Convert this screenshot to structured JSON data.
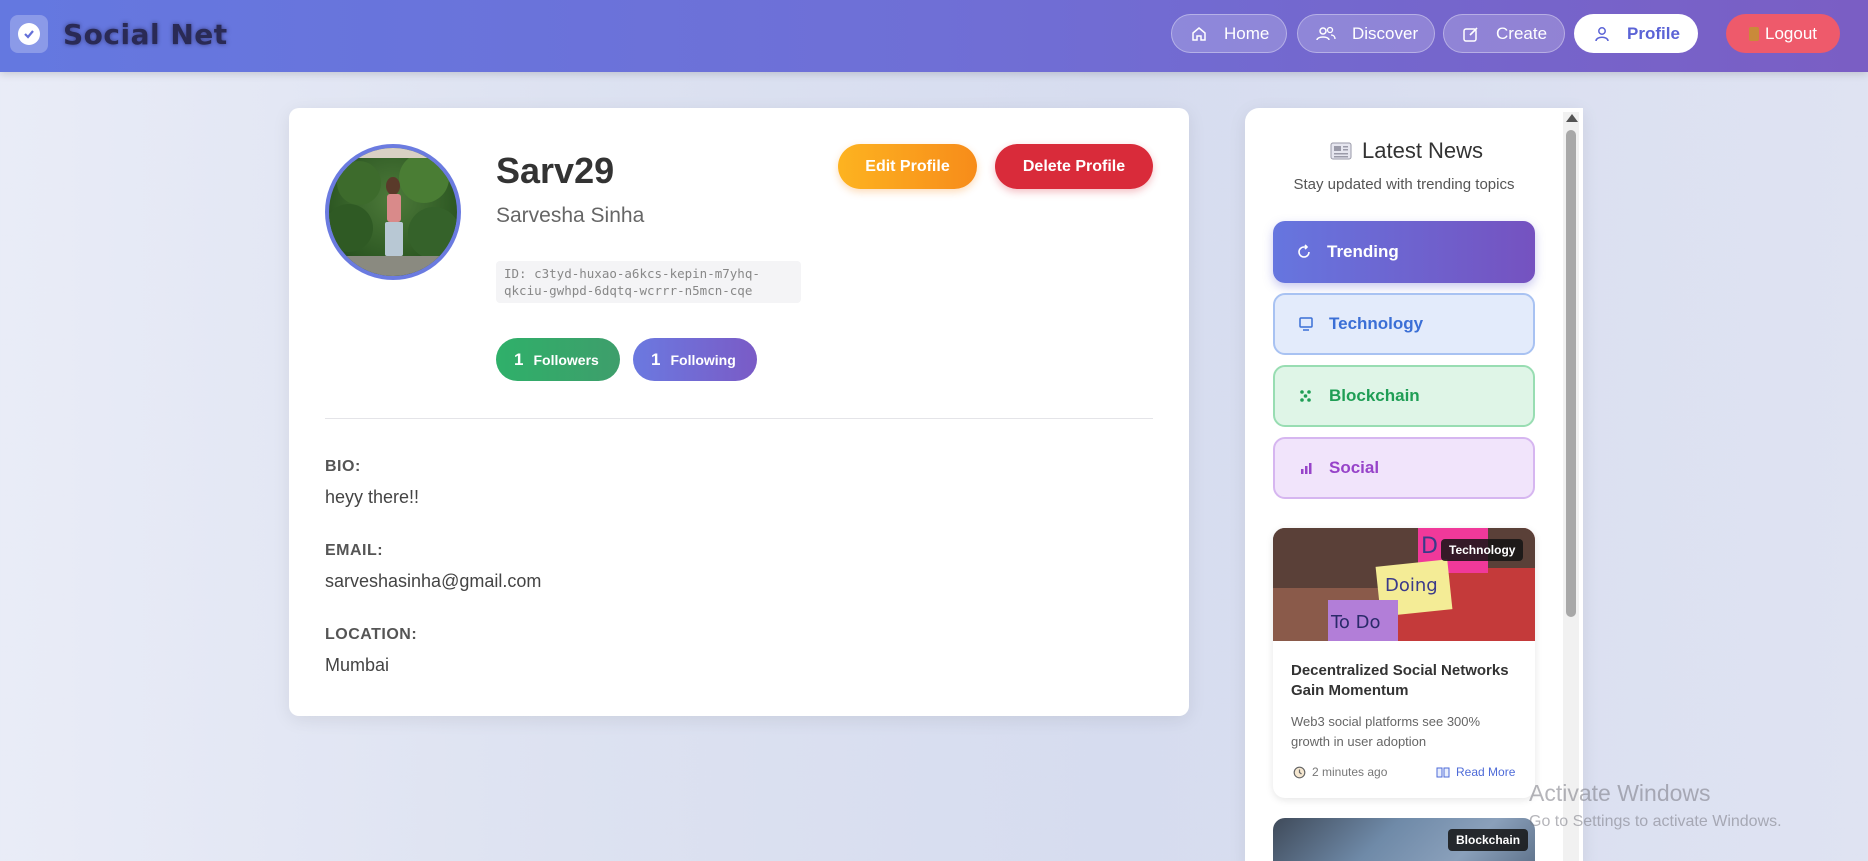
{
  "header": {
    "brand": "Social Net",
    "nav": [
      {
        "label": "Home",
        "icon": "home-icon"
      },
      {
        "label": "Discover",
        "icon": "users-icon"
      },
      {
        "label": "Create",
        "icon": "edit-icon"
      },
      {
        "label": "Profile",
        "icon": "user-icon",
        "active": true
      }
    ],
    "logout_label": "Logout"
  },
  "profile": {
    "username": "Sarv29",
    "full_name": "Sarvesha Sinha",
    "id_text": "ID: c3tyd-huxao-a6kcs-kepin-m7yhq-qkciu-gwhpd-6dqtq-wcrrr-n5mcn-cqe",
    "followers_count": "1",
    "followers_label": "Followers",
    "following_count": "1",
    "following_label": "Following",
    "edit_label": "Edit Profile",
    "delete_label": "Delete Profile",
    "bio_label": "BIO:",
    "bio": "heyy there!!",
    "email_label": "EMAIL:",
    "email": "sarveshasinha@gmail.com",
    "location_label": "LOCATION:",
    "location": "Mumbai"
  },
  "news": {
    "title": "Latest News",
    "subtitle": "Stay updated with trending topics",
    "categories": [
      {
        "label": "Trending",
        "icon": "refresh-icon"
      },
      {
        "label": "Technology",
        "icon": "monitor-icon"
      },
      {
        "label": "Blockchain",
        "icon": "dots-icon"
      },
      {
        "label": "Social",
        "icon": "chart-icon"
      }
    ],
    "articles": [
      {
        "badge": "Technology",
        "title": "Decentralized Social Networks Gain Momentum",
        "description": "Web3 social platforms see 300% growth in user adoption",
        "time": "2 minutes ago",
        "read_more": "Read More"
      },
      {
        "badge": "Blockchain"
      }
    ]
  },
  "watermark": {
    "line1": "Activate Windows",
    "line2": "Go to Settings to activate Windows."
  },
  "colors": {
    "header_start": "#6478e0",
    "header_end": "#7a5ec4",
    "accent": "#5b63d6",
    "delete": "#d92b3a",
    "logout": "#ee5a6b"
  }
}
